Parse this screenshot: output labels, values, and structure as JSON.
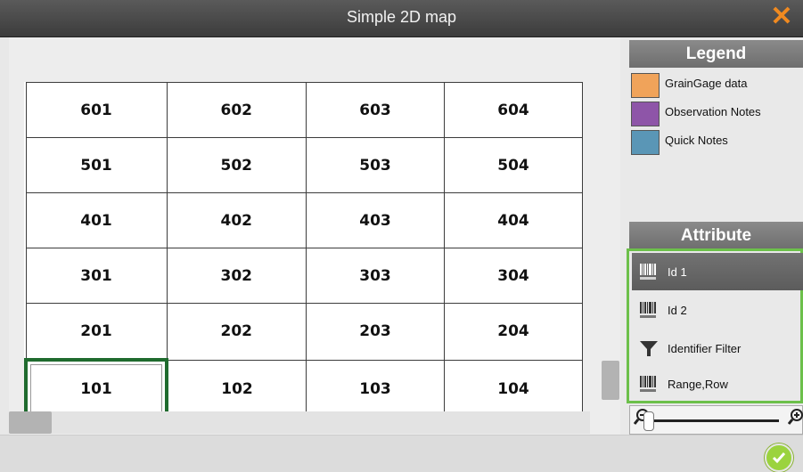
{
  "window": {
    "title": "Simple 2D map",
    "close_glyph": "✕"
  },
  "grid": {
    "rows": [
      [
        "601",
        "602",
        "603",
        "604"
      ],
      [
        "501",
        "502",
        "503",
        "504"
      ],
      [
        "401",
        "402",
        "403",
        "404"
      ],
      [
        "301",
        "302",
        "303",
        "304"
      ],
      [
        "201",
        "202",
        "203",
        "204"
      ],
      [
        "101",
        "102",
        "103",
        "104"
      ]
    ],
    "selected": "101"
  },
  "legend": {
    "title": "Legend",
    "items": [
      {
        "label": "GrainGage data",
        "color": "#f0a35a"
      },
      {
        "label": "Observation Notes",
        "color": "#8e55a8"
      },
      {
        "label": "Quick Notes",
        "color": "#5a96b6"
      }
    ]
  },
  "attribute": {
    "title": "Attribute",
    "items": [
      {
        "label": "Id 1",
        "icon": "barcode-icon",
        "selected": true
      },
      {
        "label": "Id 2",
        "icon": "barcode-icon",
        "selected": false
      },
      {
        "label": "Identifier Filter",
        "icon": "filter-icon",
        "selected": false
      },
      {
        "label": "Range,Row",
        "icon": "barcode-icon",
        "selected": false
      }
    ]
  },
  "zoom": {
    "zoom_out_icon": "zoom-out-icon",
    "zoom_in_icon": "zoom-in-icon",
    "level": 0
  },
  "colors": {
    "accent_green": "#6cc04a",
    "selected_cell_border": "#1f6b2e",
    "close_orange": "#f08a20",
    "ok_green": "#9bd33e"
  }
}
